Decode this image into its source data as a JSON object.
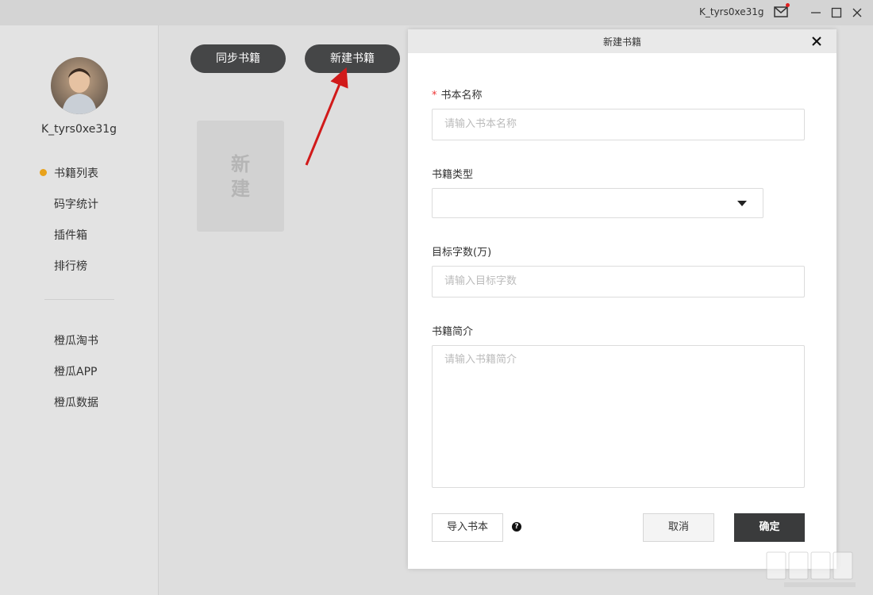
{
  "titlebar": {
    "username": "K_tyrs0xe31g",
    "icons": [
      "mail-icon",
      "minimize-icon",
      "maximize-icon",
      "close-icon"
    ]
  },
  "sidebar": {
    "username": "K_tyrs0xe31g",
    "items": [
      {
        "label": "书籍列表",
        "active": true
      },
      {
        "label": "码字统计"
      },
      {
        "label": "插件箱"
      },
      {
        "label": "排行榜"
      }
    ],
    "links": [
      {
        "label": "橙瓜淘书"
      },
      {
        "label": "橙瓜APP"
      },
      {
        "label": "橙瓜数据"
      }
    ],
    "active_color": "#e8a21b"
  },
  "toolbar": {
    "sync_label": "同步书籍",
    "new_label": "新建书籍"
  },
  "new_card": {
    "text": "新\n建"
  },
  "dialog": {
    "title": "新建书籍",
    "fields": {
      "name": {
        "required_mark": "*",
        "label": "书本名称",
        "placeholder": "请输入书本名称"
      },
      "type": {
        "label": "书籍类型",
        "value": ""
      },
      "target": {
        "label": "目标字数(万)",
        "placeholder": "请输入目标字数"
      },
      "intro": {
        "label": "书籍简介",
        "placeholder": "请输入书籍简介"
      }
    },
    "import_label": "导入书本",
    "help_glyph": "?",
    "cancel_label": "取消",
    "ok_label": "确定"
  }
}
